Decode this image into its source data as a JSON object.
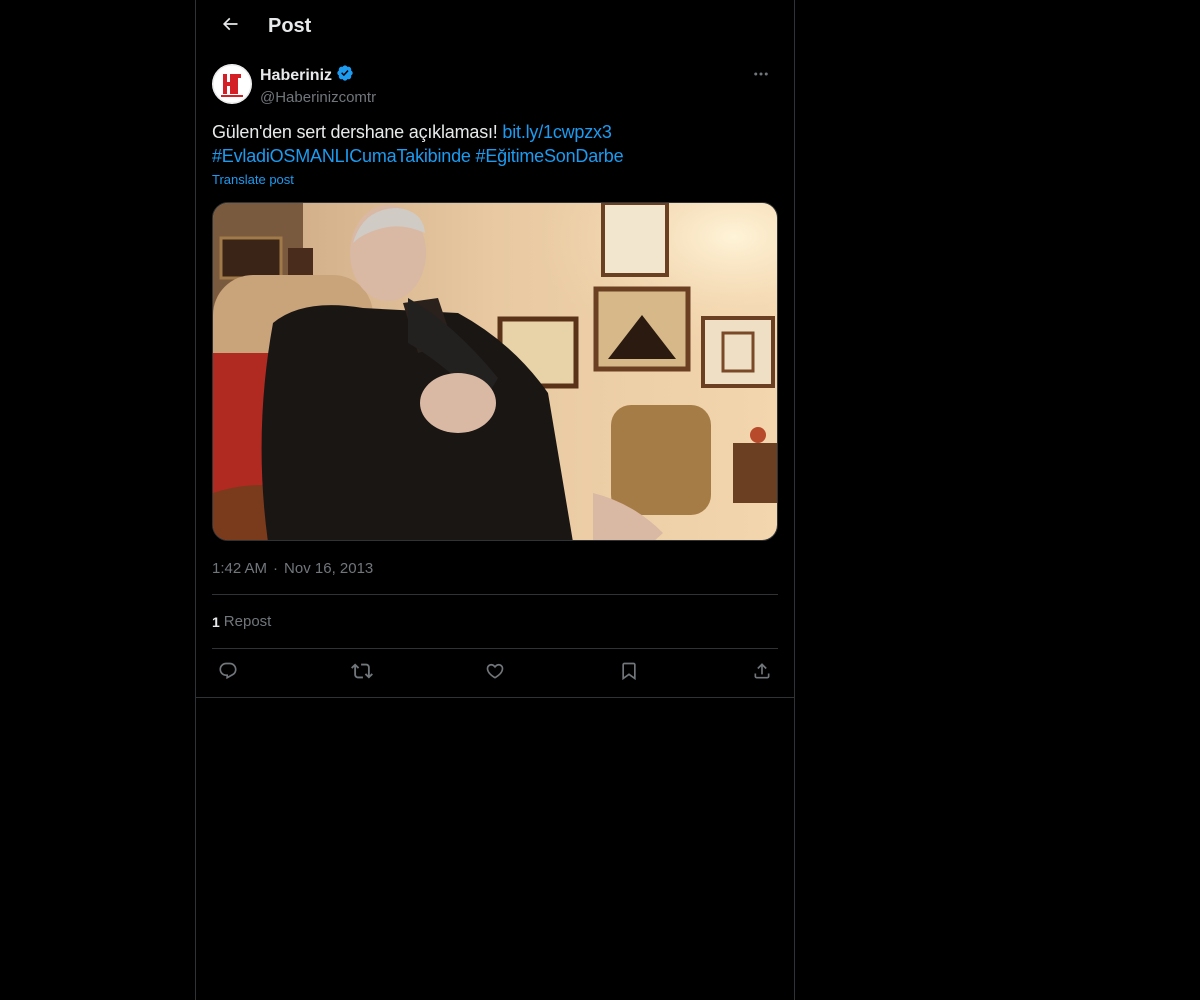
{
  "header": {
    "title": "Post"
  },
  "author": {
    "display_name": "Haberiniz",
    "handle": "@Haberinizcomtr",
    "verified": true,
    "avatar_text": "HABERİNİZ",
    "avatar_color": "#d31f26"
  },
  "post": {
    "text": "Gülen'den sert dershane açıklaması! ",
    "link": "bit.ly/1cwpzx3",
    "hashtags": [
      "#EvladiOSMANLICumaTakibinde",
      "#EğitimeSonDarbe"
    ],
    "translate_label": "Translate post",
    "time": "1:42 AM",
    "separator": "·",
    "date": "Nov 16, 2013"
  },
  "stats": {
    "repost_count": "1",
    "repost_label": "Repost"
  },
  "actions": [
    "reply-icon",
    "repost-icon",
    "like-icon",
    "bookmark-icon",
    "share-icon"
  ],
  "colors": {
    "accent": "#1d9bf0",
    "muted": "#71767b",
    "border": "#2f3336"
  }
}
